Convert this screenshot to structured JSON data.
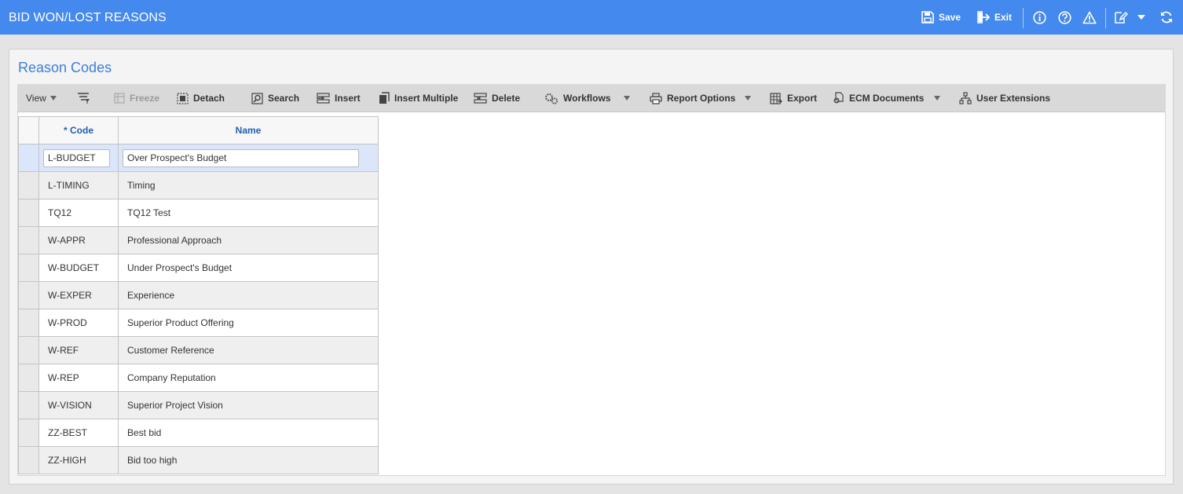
{
  "app": {
    "title": "BID WON/LOST REASONS",
    "actions": {
      "save": "Save",
      "exit": "Exit"
    },
    "icons": [
      "save-icon",
      "exit-icon",
      "info-icon",
      "help-icon",
      "warning-icon",
      "edit-icon",
      "chevron-down-icon",
      "refresh-icon"
    ]
  },
  "panel": {
    "title": "Reason Codes"
  },
  "toolbar": {
    "view": "View",
    "freeze": "Freeze",
    "detach": "Detach",
    "search": "Search",
    "insert": "Insert",
    "insert_multiple": "Insert Multiple",
    "delete": "Delete",
    "workflows": "Workflows",
    "report_options": "Report Options",
    "export": "Export",
    "ecm_documents": "ECM Documents",
    "user_extensions": "User Extensions"
  },
  "grid": {
    "columns": {
      "code": "* Code",
      "name": "Name"
    },
    "active_row": {
      "code": "L-BUDGET",
      "name": "Over Prospect's Budget"
    },
    "rows": [
      {
        "code": "L-TIMING",
        "name": "Timing"
      },
      {
        "code": "TQ12",
        "name": "TQ12 Test"
      },
      {
        "code": "W-APPR",
        "name": "Professional Approach"
      },
      {
        "code": "W-BUDGET",
        "name": "Under Prospect's Budget"
      },
      {
        "code": "W-EXPER",
        "name": "Experience"
      },
      {
        "code": "W-PROD",
        "name": "Superior Product Offering"
      },
      {
        "code": "W-REF",
        "name": "Customer Reference"
      },
      {
        "code": "W-REP",
        "name": "Company Reputation"
      },
      {
        "code": "W-VISION",
        "name": "Superior Project Vision"
      },
      {
        "code": "ZZ-BEST",
        "name": "Best bid"
      },
      {
        "code": "ZZ-HIGH",
        "name": "Bid too high"
      }
    ]
  },
  "colors": {
    "header": "#4489ee",
    "panel_title": "#3d80d8",
    "column_header": "#1f5fb3",
    "active_row": "#dbe6fb"
  }
}
